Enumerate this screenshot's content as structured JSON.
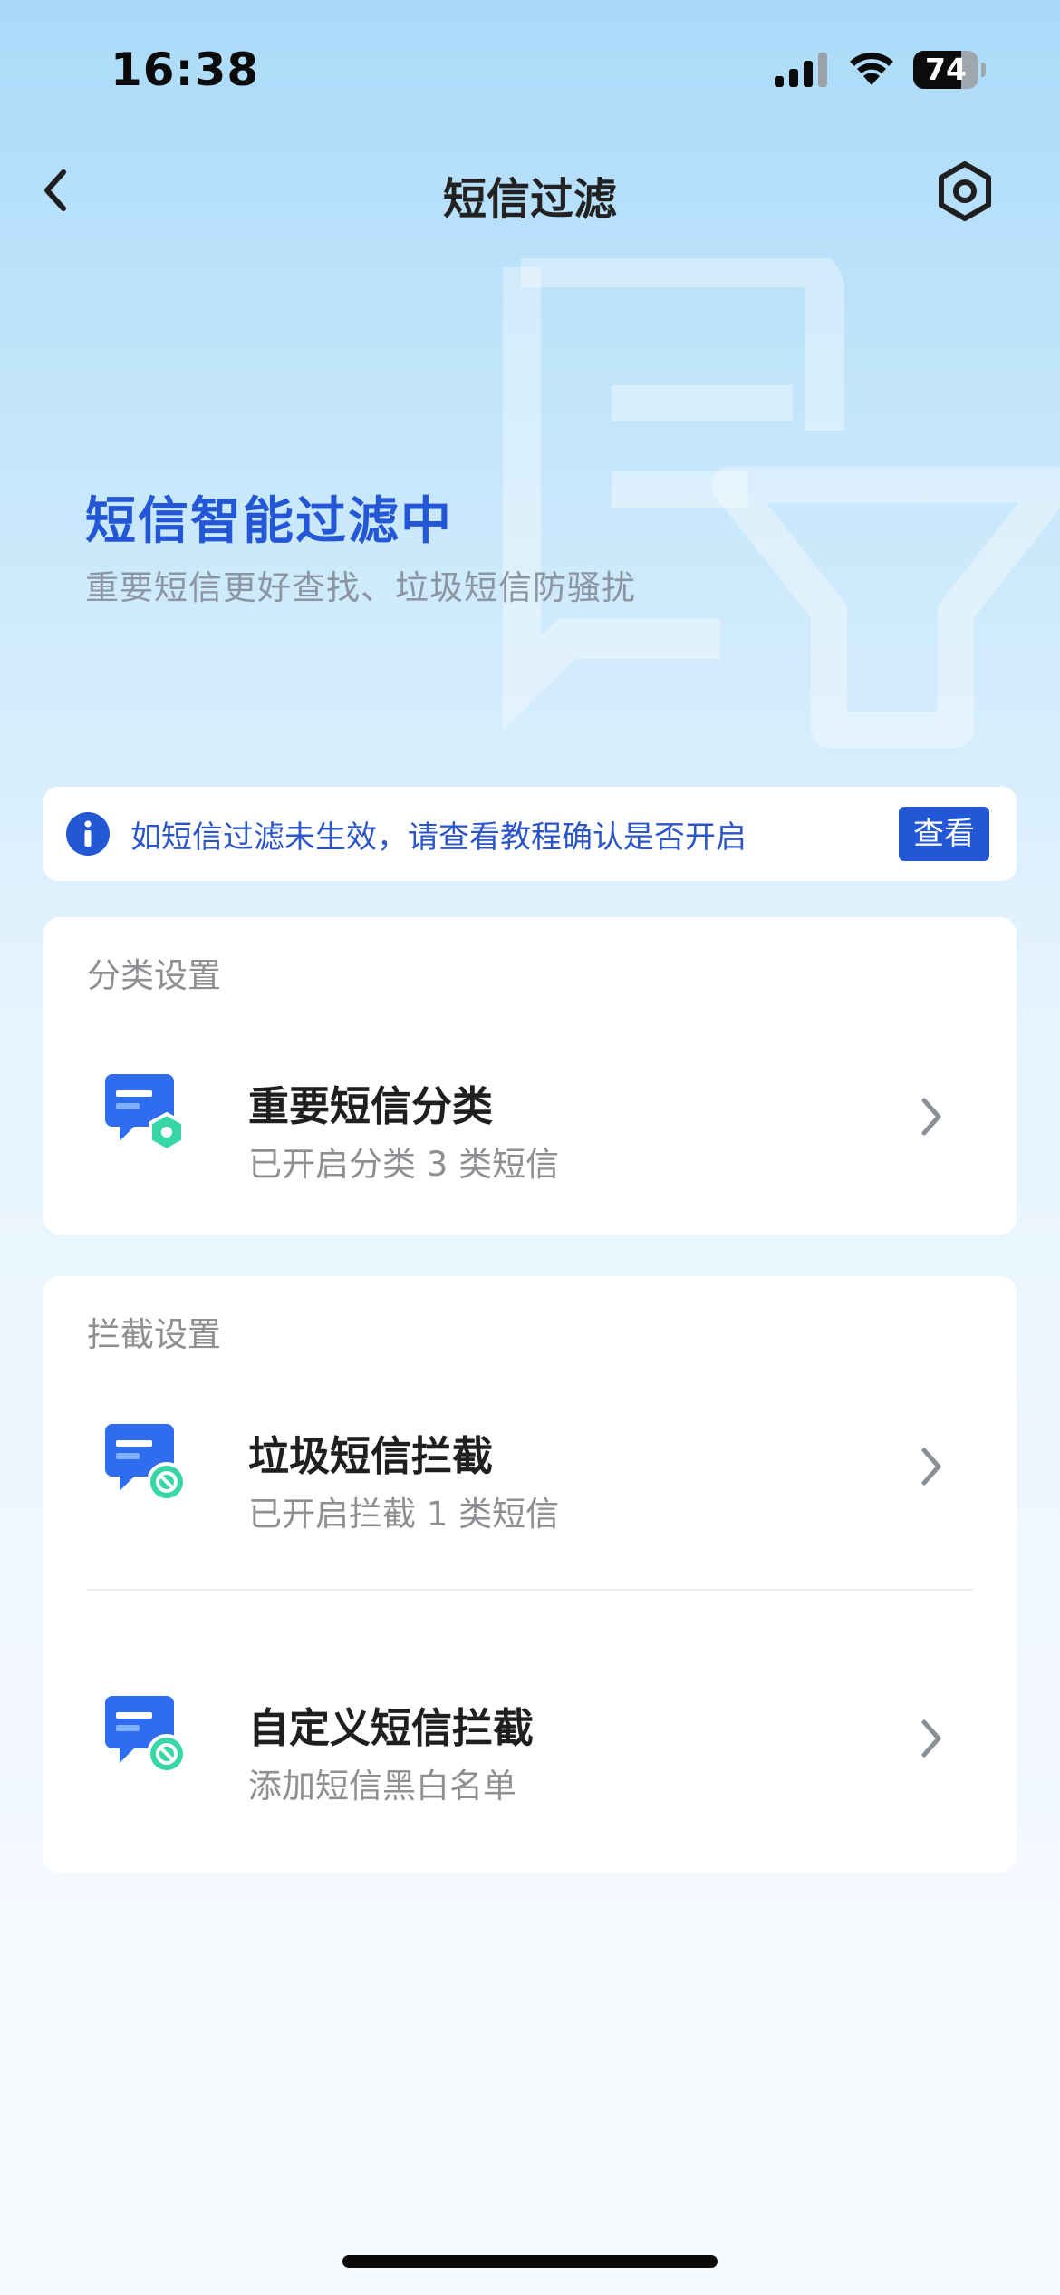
{
  "status_bar": {
    "time": "16:38",
    "battery": "74",
    "battery_level": 0.74
  },
  "nav": {
    "title": "短信过滤",
    "back_icon": "chevron-left-icon",
    "settings_icon": "hexagon-gear-icon"
  },
  "hero": {
    "title": "短信智能过滤中",
    "subtitle": "重要短信更好查找、垃圾短信防骚扰"
  },
  "notice": {
    "text": "如短信过滤未生效，请查看教程确认是否开启",
    "button": "查看",
    "icon": "info-icon"
  },
  "sections": [
    {
      "title": "分类设置",
      "items": [
        {
          "label": "重要短信分类",
          "desc": "已开启分类 3 类短信",
          "icon": "message-shield-icon"
        }
      ]
    },
    {
      "title": "拦截设置",
      "items": [
        {
          "label": "垃圾短信拦截",
          "desc": "已开启拦截 1 类短信",
          "icon": "message-block-icon"
        },
        {
          "label": "自定义短信拦截",
          "desc": "添加短信黑白名单",
          "icon": "message-block-icon"
        }
      ]
    }
  ],
  "colors": {
    "accent": "#2457d6",
    "icon_blue": "#2f6cf0",
    "icon_green": "#37d6a6"
  }
}
